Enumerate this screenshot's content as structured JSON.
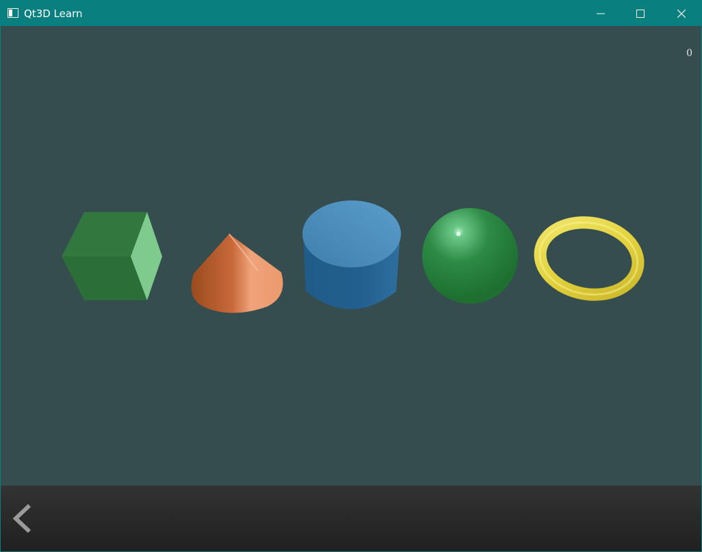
{
  "window": {
    "title": "Qt3D Learn",
    "controls": {
      "minimize_icon": "minimize-icon",
      "maximize_icon": "maximize-icon",
      "close_icon": "close-icon"
    },
    "title_bar_color": "#0a7f80"
  },
  "scene": {
    "background_color": "#354d4e",
    "counter_value": "0",
    "shapes": [
      {
        "name": "cube",
        "color": "#2e7b3d"
      },
      {
        "name": "cone",
        "color": "#e08a57"
      },
      {
        "name": "cylinder",
        "color": "#3a7db0"
      },
      {
        "name": "sphere",
        "color": "#2a8a45"
      },
      {
        "name": "torus",
        "color": "#e0d23a"
      }
    ]
  },
  "bottom_bar": {
    "back_icon": "chevron-left-icon"
  }
}
